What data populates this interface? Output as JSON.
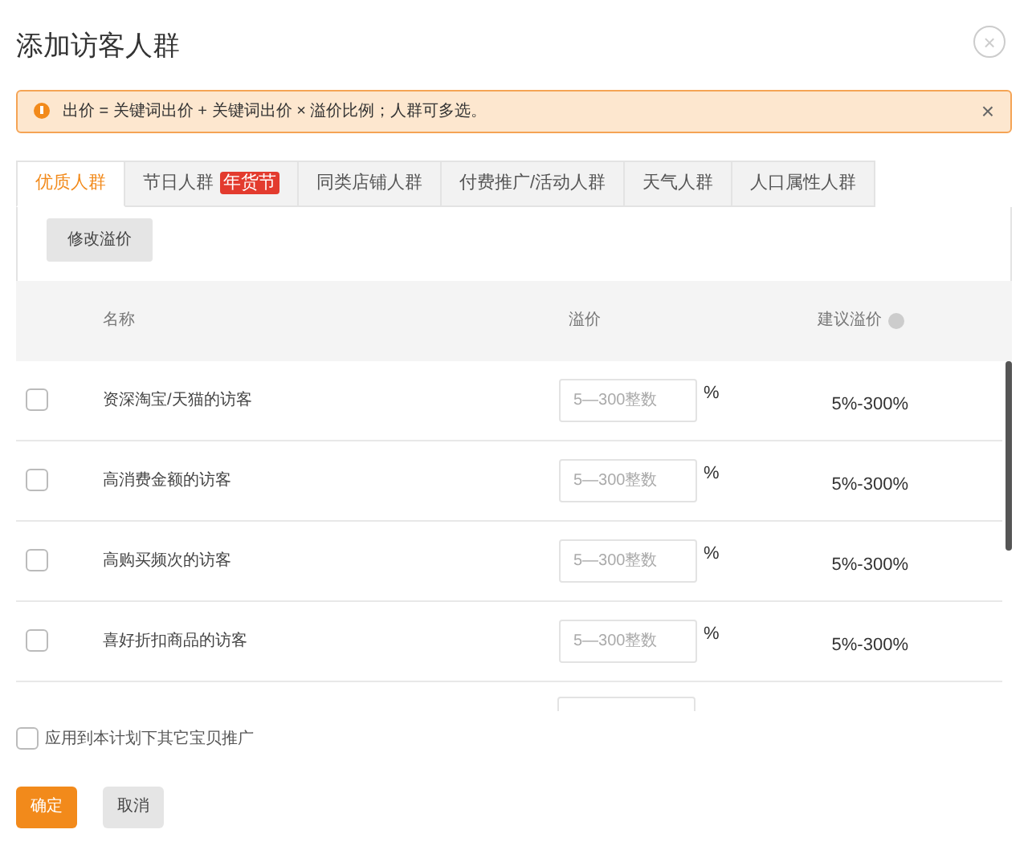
{
  "dialog": {
    "title": "添加访客人群",
    "close": "×"
  },
  "alert": {
    "text": "出价 = 关键词出价 + 关键词出价 × 溢价比例；人群可多选。",
    "close": "×"
  },
  "tabs": [
    {
      "label": "优质人群",
      "selected": true
    },
    {
      "label": "节日人群",
      "badge": "年货节",
      "selected": false
    },
    {
      "label": "同类店铺人群",
      "selected": false
    },
    {
      "label": "付费推广/活动人群",
      "selected": false
    },
    {
      "label": "天气人群",
      "selected": false
    },
    {
      "label": "人口属性人群",
      "selected": false
    }
  ],
  "toolbar": {
    "button": "修改溢价"
  },
  "table": {
    "columns": [
      "名称",
      "溢价",
      "建议溢价"
    ],
    "rows": [
      {
        "name": "资深淘宝/天猫的访客",
        "checked": false,
        "placeholder": "5—300整数",
        "unit": "%",
        "suggested": "5%-300%"
      },
      {
        "name": "高消费金额的访客",
        "checked": false,
        "placeholder": "5—300整数",
        "unit": "%",
        "suggested": "5%-300%"
      },
      {
        "name": "高购买频次的访客",
        "checked": false,
        "placeholder": "5—300整数",
        "unit": "%",
        "suggested": "5%-300%"
      },
      {
        "name": "喜好折扣商品的访客",
        "checked": false,
        "placeholder": "5—300整数",
        "unit": "%",
        "suggested": "5%-300%"
      }
    ]
  },
  "apply_all": {
    "label": "应用到本计划下其它宝贝推广",
    "checked": false
  },
  "buttons": [
    {
      "label": "确定",
      "kind": "primary"
    },
    {
      "label": "取消",
      "kind": "secondary"
    }
  ]
}
